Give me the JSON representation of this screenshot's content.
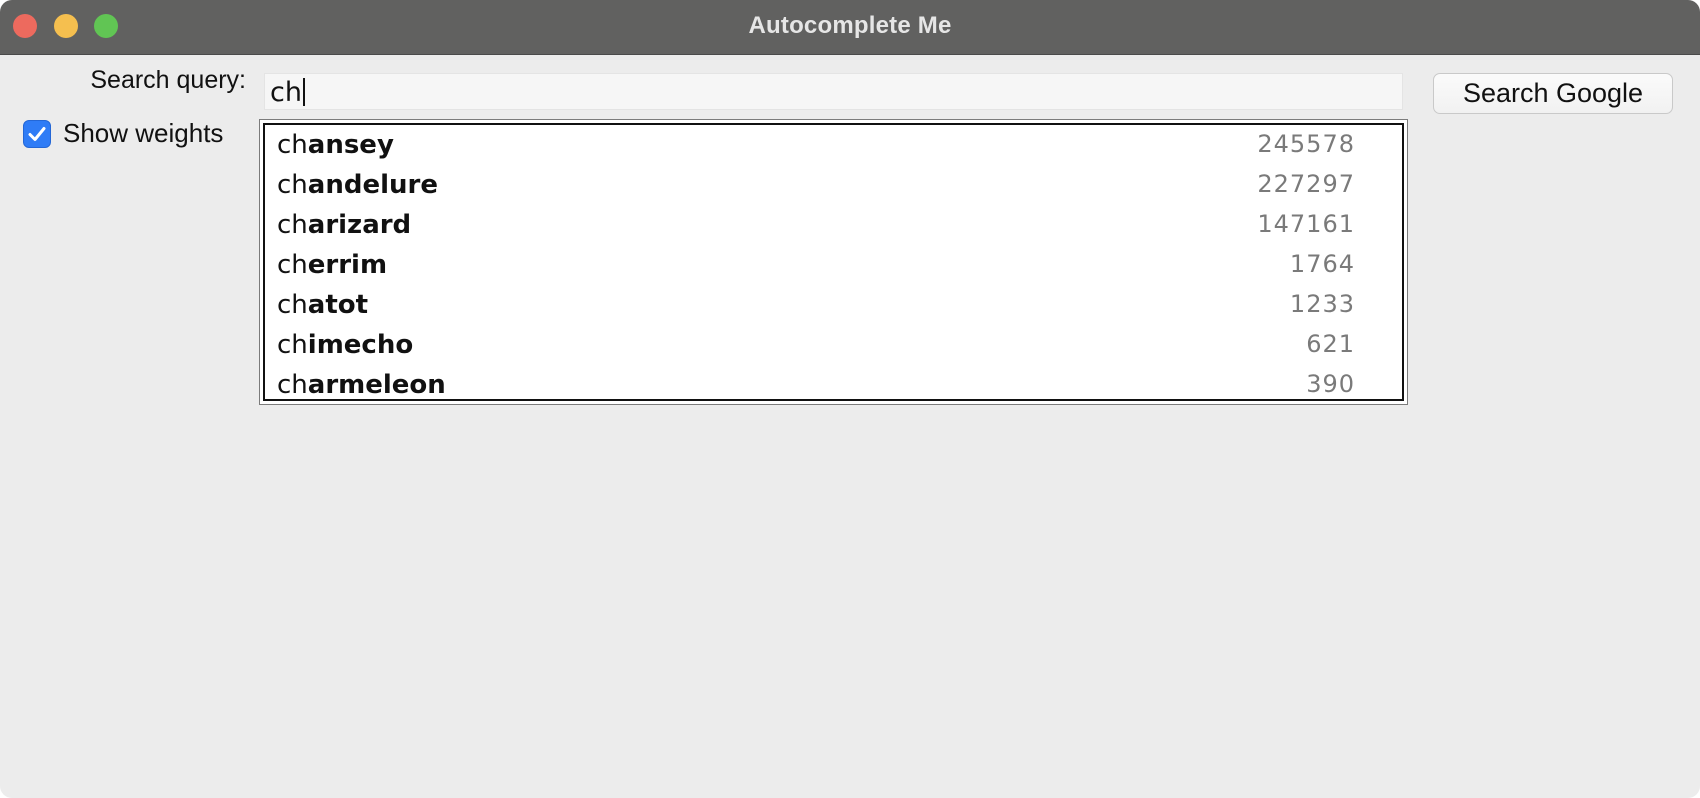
{
  "window": {
    "title": "Autocomplete Me",
    "controls": [
      "close",
      "minimize",
      "maximize"
    ]
  },
  "search": {
    "label": "Search query:",
    "value": "ch",
    "button_label": "Search Google"
  },
  "options": {
    "show_weights_label": "Show weights",
    "show_weights_checked": true
  },
  "suggestions": {
    "items": [
      {
        "prefix": "ch",
        "rest": "ansey",
        "weight": "245578"
      },
      {
        "prefix": "ch",
        "rest": "andelure",
        "weight": "227297"
      },
      {
        "prefix": "ch",
        "rest": "arizard",
        "weight": "147161"
      },
      {
        "prefix": "ch",
        "rest": "errim",
        "weight": "1764"
      },
      {
        "prefix": "ch",
        "rest": "atot",
        "weight": "1233"
      },
      {
        "prefix": "ch",
        "rest": "imecho",
        "weight": "621"
      },
      {
        "prefix": "ch",
        "rest": "armeleon",
        "weight": "390"
      }
    ]
  },
  "colors": {
    "titlebar": "#616160",
    "window_bg": "#ececec",
    "checkbox_accent": "#2f7cf6",
    "weight_text": "#7a7a7a"
  }
}
